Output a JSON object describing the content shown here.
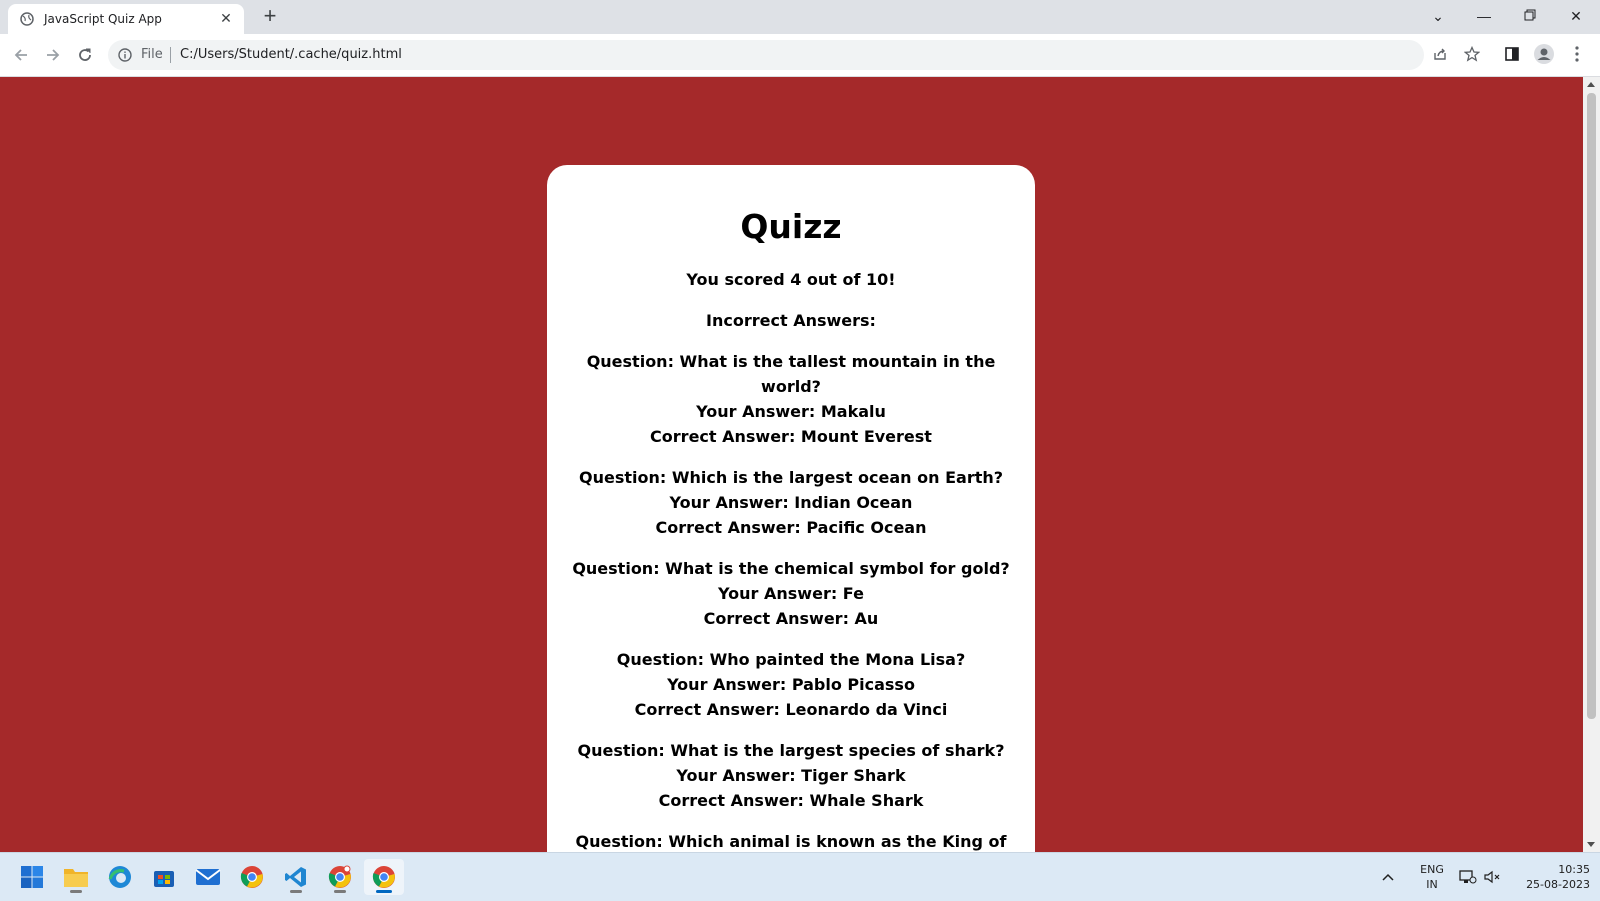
{
  "browser": {
    "tab_title": "JavaScript Quiz App",
    "file_label": "File",
    "url": "C:/Users/Student/.cache/quiz.html"
  },
  "quiz": {
    "title": "Quizz",
    "score_text": "You scored 4 out of 10!",
    "incorrect_heading": "Incorrect Answers:",
    "incorrect_answers": [
      {
        "question": "Question: What is the tallest mountain in the world?",
        "your_answer": "Your Answer: Makalu",
        "correct_answer": "Correct Answer: Mount Everest"
      },
      {
        "question": "Question: Which is the largest ocean on Earth?",
        "your_answer": "Your Answer: Indian Ocean",
        "correct_answer": "Correct Answer: Pacific Ocean"
      },
      {
        "question": "Question: What is the chemical symbol for gold?",
        "your_answer": "Your Answer: Fe",
        "correct_answer": "Correct Answer: Au"
      },
      {
        "question": "Question: Who painted the Mona Lisa?",
        "your_answer": "Your Answer: Pablo Picasso",
        "correct_answer": "Correct Answer: Leonardo da Vinci"
      },
      {
        "question": "Question: What is the largest species of shark?",
        "your_answer": "Your Answer: Tiger Shark",
        "correct_answer": "Correct Answer: Whale Shark"
      },
      {
        "question": "Question: Which animal is known as the King of the Jungle?",
        "your_answer": "",
        "correct_answer": ""
      }
    ]
  },
  "taskbar": {
    "lang_top": "ENG",
    "lang_bottom": "IN",
    "time": "10:35",
    "date": "25-08-2023"
  },
  "colors": {
    "page_background": "#a5292a",
    "card_background": "#ffffff"
  }
}
